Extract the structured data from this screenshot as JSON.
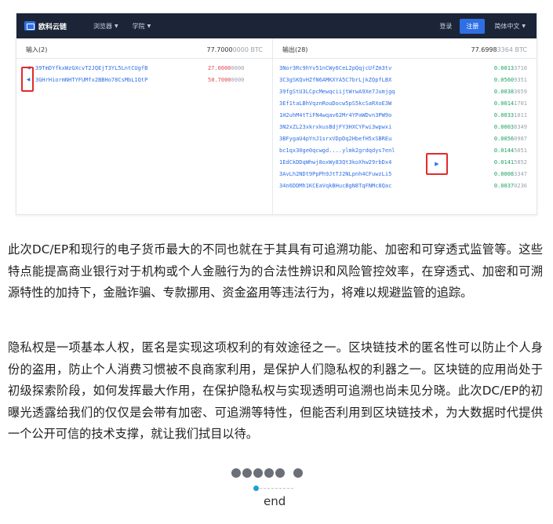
{
  "explorer": {
    "brand": "欧科云链",
    "nav": [
      "浏览器",
      "学院"
    ],
    "login": "登录",
    "register": "注册",
    "language": "简体中文",
    "inputs_header": "输入(2)",
    "inputs_total_main": "77.7000",
    "inputs_total_dim": "0000 BTC",
    "outputs_header": "输出(28)",
    "outputs_total_main": "77.6998",
    "outputs_total_dim": "3364 BTC",
    "inputs": [
      {
        "address": "39TmDYfkxWzGXcvT2JQEjT3YL5LntCUgfB",
        "amt_main": "27.0000",
        "amt_dim": "0000"
      },
      {
        "address": "3GHrHiormNHTYFUMfx2BBHo78CsMbL1QtP",
        "amt_main": "50.7000",
        "amt_dim": "0000"
      }
    ],
    "outputs": [
      {
        "address": "3Nor3Rc9hYv51nCWy6CeL2pQqjcUfZm3tv",
        "amt_main": "0.0013",
        "amt_dim": "3710"
      },
      {
        "address": "3C3gSKQvHZfN6AMKXYA5C7brLjkZQpfLBX",
        "amt_main": "0.0560",
        "amt_dim": "9351"
      },
      {
        "address": "39fgStU3LCpcMewqciijtWrwA9Xe7Jumjgq",
        "amt_main": "0.0038",
        "amt_dim": "3659"
      },
      {
        "address": "3Ef1taLBhVqznRouDocw5pS5kcSaRXoE3W",
        "amt_main": "0.0014",
        "amt_dim": "1701"
      },
      {
        "address": "1H2uhM4tTiFN4wqav62Mr4YPaWDvn3PW9o",
        "amt_main": "0.0033",
        "amt_dim": "1011"
      },
      {
        "address": "3N2xZL23xkrxkusBdjFY3HXCYFwi3wpwxi",
        "amt_main": "0.0003",
        "amt_dim": "8349"
      },
      {
        "address": "3BFygaU4pYnJ1srxVDpDq2HbefH5xSBREu",
        "amt_main": "0.0056",
        "amt_dim": "0987"
      },
      {
        "address": "bc1qx30ge0qcwgd....ylmk2grdqdys7enl",
        "amt_main": "0.0144",
        "amt_dim": "5051"
      },
      {
        "address": "1EdCkDDqWhwj8oxWy83Qt3koXhw29rbDx4",
        "amt_main": "0.0141",
        "amt_dim": "5852"
      },
      {
        "address": "3AvLh2NDt9PpPh9JtTJ2NLpnh4CFuwzLi5",
        "amt_main": "0.0008",
        "amt_dim": "3347"
      },
      {
        "address": "34n6DDMh1KCEaVqkBHucBgN8TqFNMc8Qac",
        "amt_main": "0.0037",
        "amt_dim": "0236"
      }
    ]
  },
  "article": {
    "paragraph1": "此次DC/EP和现行的电子货币最大的不同也就在于其具有可追溯功能、加密和可穿透式监管等。这些特点能提高商业银行对于机构或个人金融行为的合法性辨识和风险管控效率，在穿透式、加密和可溯源特性的加持下，金融诈骗、专款挪用、资金盗用等违法行为，将难以规避监管的追踪。",
    "paragraph2": "隐私权是一项基本人权，匿名是实现这项权利的有效途径之一。区块链技术的匿名性可以防止个人身份的盗用，防止个人消费习惯被不良商家利用，是保护人们隐私权的利器之一。区块链的应用尚处于初级探索阶段，如何发挥最大作用，在保护隐私权与实现透明可追溯也尚未见分晓。此次DC/EP的初曝光透露给我们的仅仅是会带有加密、可追溯等特性，但能否利用到区块链技术，为大数据时代提供一个公开可信的技术支撑，就让我们拭目以待。",
    "end_label": "end"
  }
}
